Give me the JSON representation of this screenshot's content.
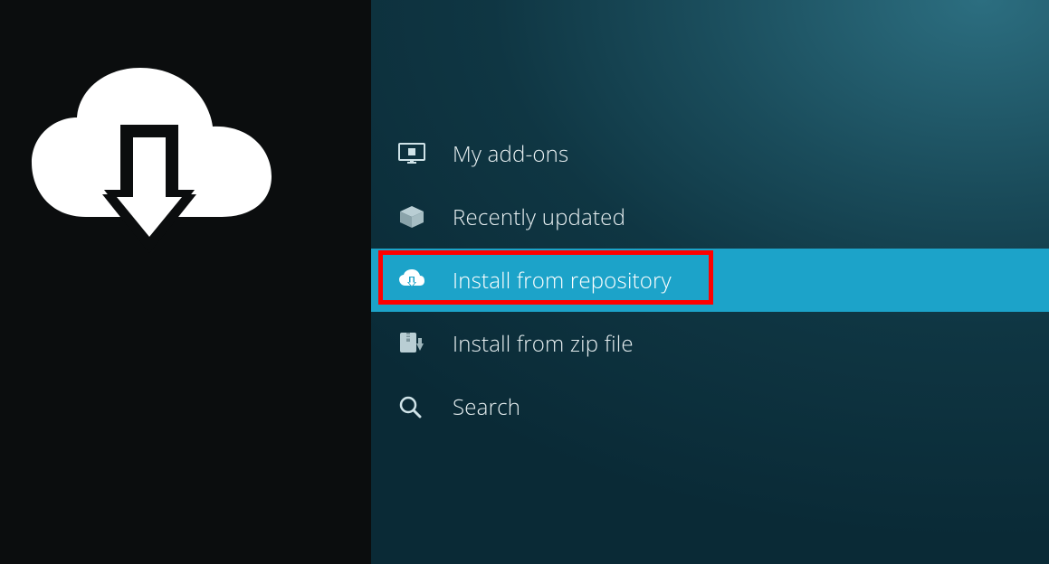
{
  "sidebar": {
    "icon": "cloud-download-icon"
  },
  "menu": {
    "items": [
      {
        "icon": "monitor-box-icon",
        "label": "My add-ons",
        "selected": false
      },
      {
        "icon": "open-box-icon",
        "label": "Recently updated",
        "selected": false
      },
      {
        "icon": "cloud-download-small-icon",
        "label": "Install from repository",
        "selected": true,
        "highlighted": true
      },
      {
        "icon": "zip-install-icon",
        "label": "Install from zip file",
        "selected": false
      },
      {
        "icon": "search-icon",
        "label": "Search",
        "selected": false
      }
    ]
  },
  "colors": {
    "selected_bg": "#1ca3c9",
    "highlight_border": "#ff0000"
  }
}
